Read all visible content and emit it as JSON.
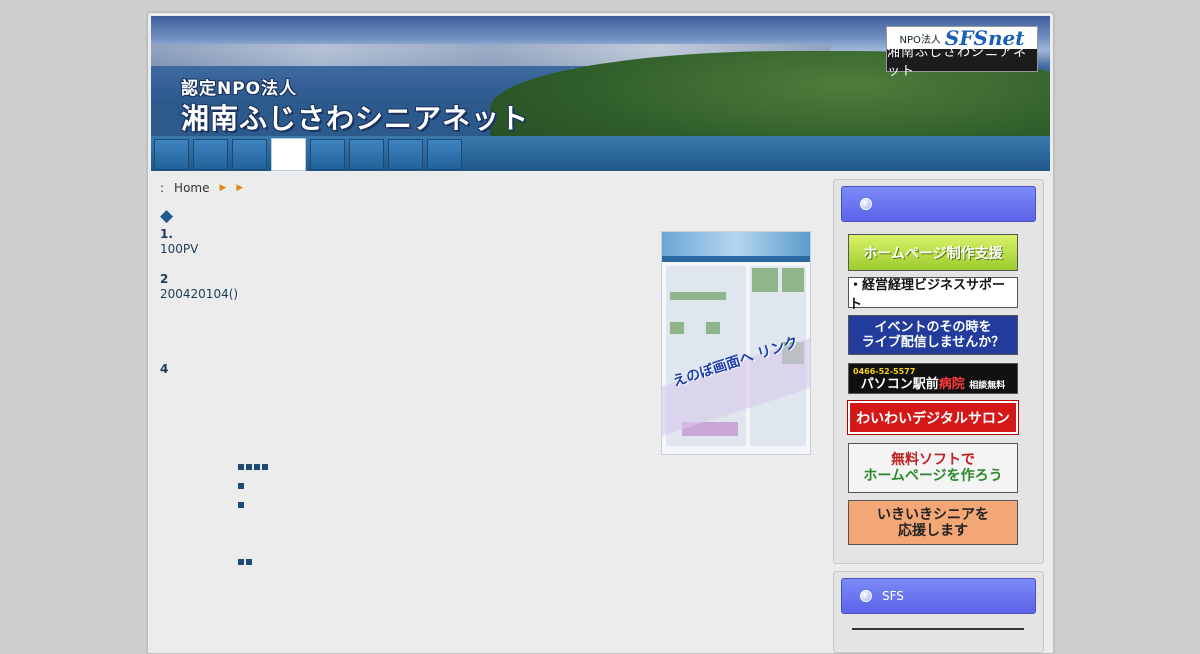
{
  "header": {
    "title_small": "認定NPO法人",
    "title_big": "湘南ふじさわシニアネット",
    "logo_prefix": "NPO法人",
    "logo_name": "SFSnet",
    "logo_caption": "湘南ふじさわシニアネット"
  },
  "nav": {
    "tabs": [
      "",
      "",
      "",
      "",
      "",
      "",
      "",
      ""
    ],
    "active_index": 3
  },
  "breadcrumb": {
    "separator": ":",
    "home": "Home"
  },
  "main": {
    "marker": "◆",
    "item1_heading": "1.",
    "item1_text": "100PV",
    "item2_heading": "2",
    "item2_text": "200420104()",
    "item4_heading": "4",
    "screenshot_label": "えのぼ画面へ リンク"
  },
  "sidebar": {
    "box1_title": "",
    "box2_title": "SFS",
    "banners": [
      "ホームページ制作支援",
      "・経営経理ビジネスサポート",
      "イベントのその時を",
      "ライブ配信しませんか？",
      "0466-52-5577",
      "パソコン駅前",
      "病院",
      "相談無料",
      "わいわいデジタルサロン",
      "無料ソフトで",
      "ホームページを作ろう",
      "いきいきシニアを",
      "応援します"
    ]
  }
}
